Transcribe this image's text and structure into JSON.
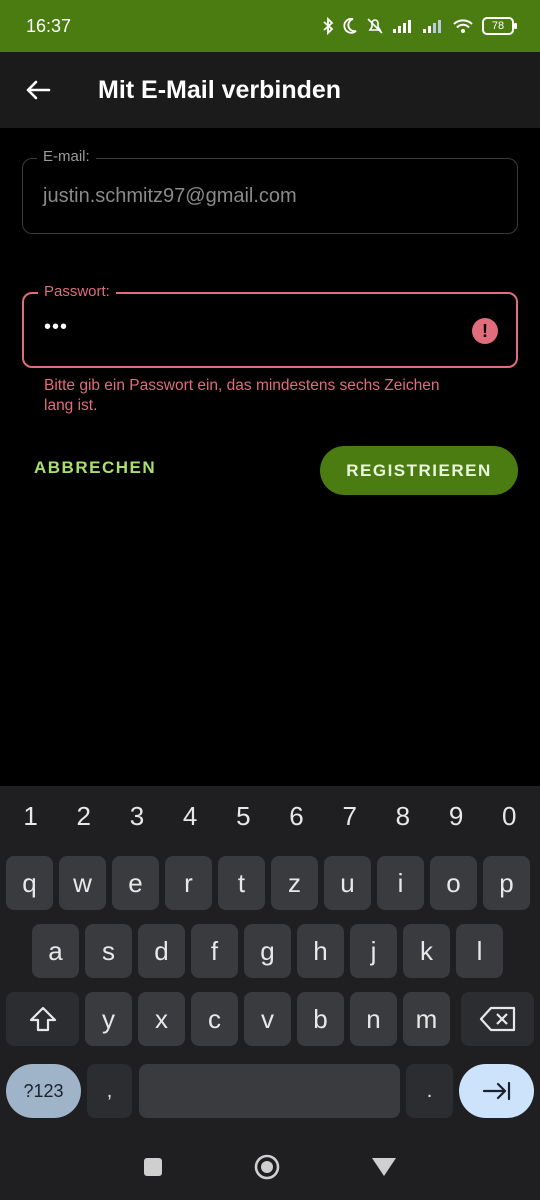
{
  "status": {
    "time": "16:37",
    "battery": "78"
  },
  "appbar": {
    "title": "Mit E-Mail verbinden",
    "back_icon": "arrow-left-icon"
  },
  "email": {
    "label": "E-mail:",
    "value": "justin.schmitz97@gmail.com"
  },
  "password": {
    "label": "Passwort:",
    "value": "•••",
    "error_icon": "!"
  },
  "error": {
    "message": "Bitte gib ein Passwort ein, das mindestens sechs Zeichen lang ist."
  },
  "actions": {
    "cancel": "ABBRECHEN",
    "register": "REGISTRIEREN"
  },
  "keyboard": {
    "numbers": [
      "1",
      "2",
      "3",
      "4",
      "5",
      "6",
      "7",
      "8",
      "9",
      "0"
    ],
    "row1": [
      "q",
      "w",
      "e",
      "r",
      "t",
      "z",
      "u",
      "i",
      "o",
      "p"
    ],
    "row2": [
      "a",
      "s",
      "d",
      "f",
      "g",
      "h",
      "j",
      "k",
      "l"
    ],
    "row3": [
      "y",
      "x",
      "c",
      "v",
      "b",
      "n",
      "m"
    ],
    "symbols_key": "?123",
    "comma_key": ",",
    "period_key": "."
  },
  "colors": {
    "accent": "#4a7c12",
    "error": "#e06c7c",
    "cancel_text": "#a8e070"
  }
}
